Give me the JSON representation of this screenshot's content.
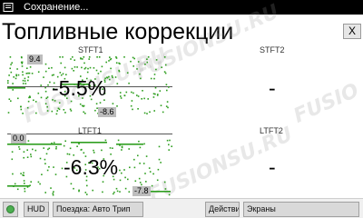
{
  "status_bar": {
    "text": "Сохранение...",
    "icon": "document-icon"
  },
  "title": "Топливные коррекции",
  "close_label": "X",
  "watermark": "FUSIONSU.RU",
  "gauges": [
    {
      "label": "STFT1",
      "value": "-5.5%",
      "max_box": "9.4",
      "min_box": "-8.6",
      "has_graph": true
    },
    {
      "label": "STFT2",
      "value": "-",
      "has_graph": false
    },
    {
      "label": "LTFT1",
      "value": "-6.3%",
      "max_box": "0.0",
      "min_box": "-7.8",
      "has_graph": true
    },
    {
      "label": "LTFT2",
      "value": "-",
      "has_graph": false
    }
  ],
  "bottom_bar": {
    "hud_label": "HUD",
    "trip_label": "Поездка: Авто Трип",
    "actions_label": "Действия",
    "screens_label": "Экраны"
  },
  "colors": {
    "graph": "#2e9e1f",
    "status_bar": "#000000",
    "indicator": "#4caf50"
  }
}
